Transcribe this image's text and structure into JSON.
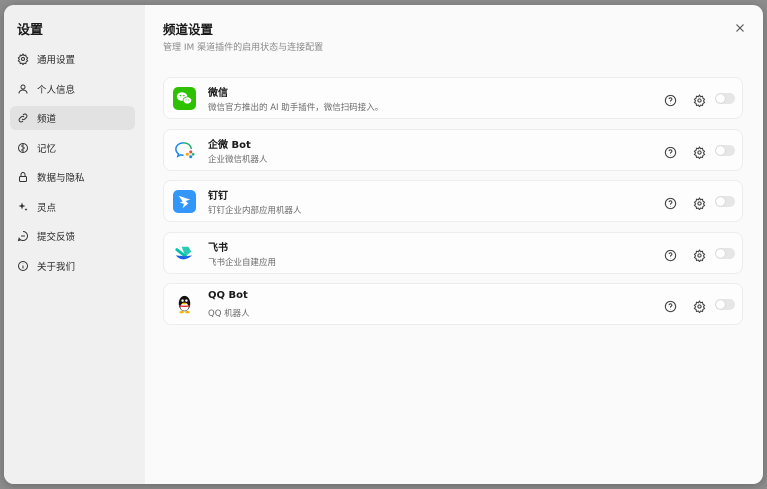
{
  "sidebar": {
    "title": "设置",
    "items": [
      {
        "label": "通用设置",
        "icon": "gear-icon",
        "active": false
      },
      {
        "label": "个人信息",
        "icon": "user-icon",
        "active": false
      },
      {
        "label": "频道",
        "icon": "link-icon",
        "active": true
      },
      {
        "label": "记忆",
        "icon": "memory-icon",
        "active": false
      },
      {
        "label": "数据与隐私",
        "icon": "lock-icon",
        "active": false
      },
      {
        "label": "灵点",
        "icon": "sparkle-icon",
        "active": false
      },
      {
        "label": "提交反馈",
        "icon": "feedback-icon",
        "active": false
      },
      {
        "label": "关于我们",
        "icon": "info-icon",
        "active": false
      }
    ]
  },
  "main": {
    "title": "频道设置",
    "subtitle": "管理 IM 渠道插件的启用状态与连接配置",
    "channels": [
      {
        "name": "微信",
        "description": "微信官方推出的 AI 助手插件，微信扫码接入。",
        "icon": "wechat-logo-icon",
        "enabled": false
      },
      {
        "name": "企微 Bot",
        "description": "企业微信机器人",
        "icon": "wecom-logo-icon",
        "enabled": false
      },
      {
        "name": "钉钉",
        "description": "钉钉企业内部应用机器人",
        "icon": "dingtalk-logo-icon",
        "enabled": false
      },
      {
        "name": "飞书",
        "description": "飞书企业自建应用",
        "icon": "feishu-logo-icon",
        "enabled": false
      },
      {
        "name": "QQ Bot",
        "description": "QQ 机器人",
        "icon": "qq-logo-icon",
        "enabled": false
      }
    ]
  },
  "colors": {
    "sidebar_bg": "#f0f0f0",
    "active_item_bg": "#e2e2e2",
    "main_bg": "#fafafa",
    "wechat_green": "#2dc100",
    "dingtalk_blue": "#3296fa",
    "toggle_off": "#e6e6e6"
  }
}
